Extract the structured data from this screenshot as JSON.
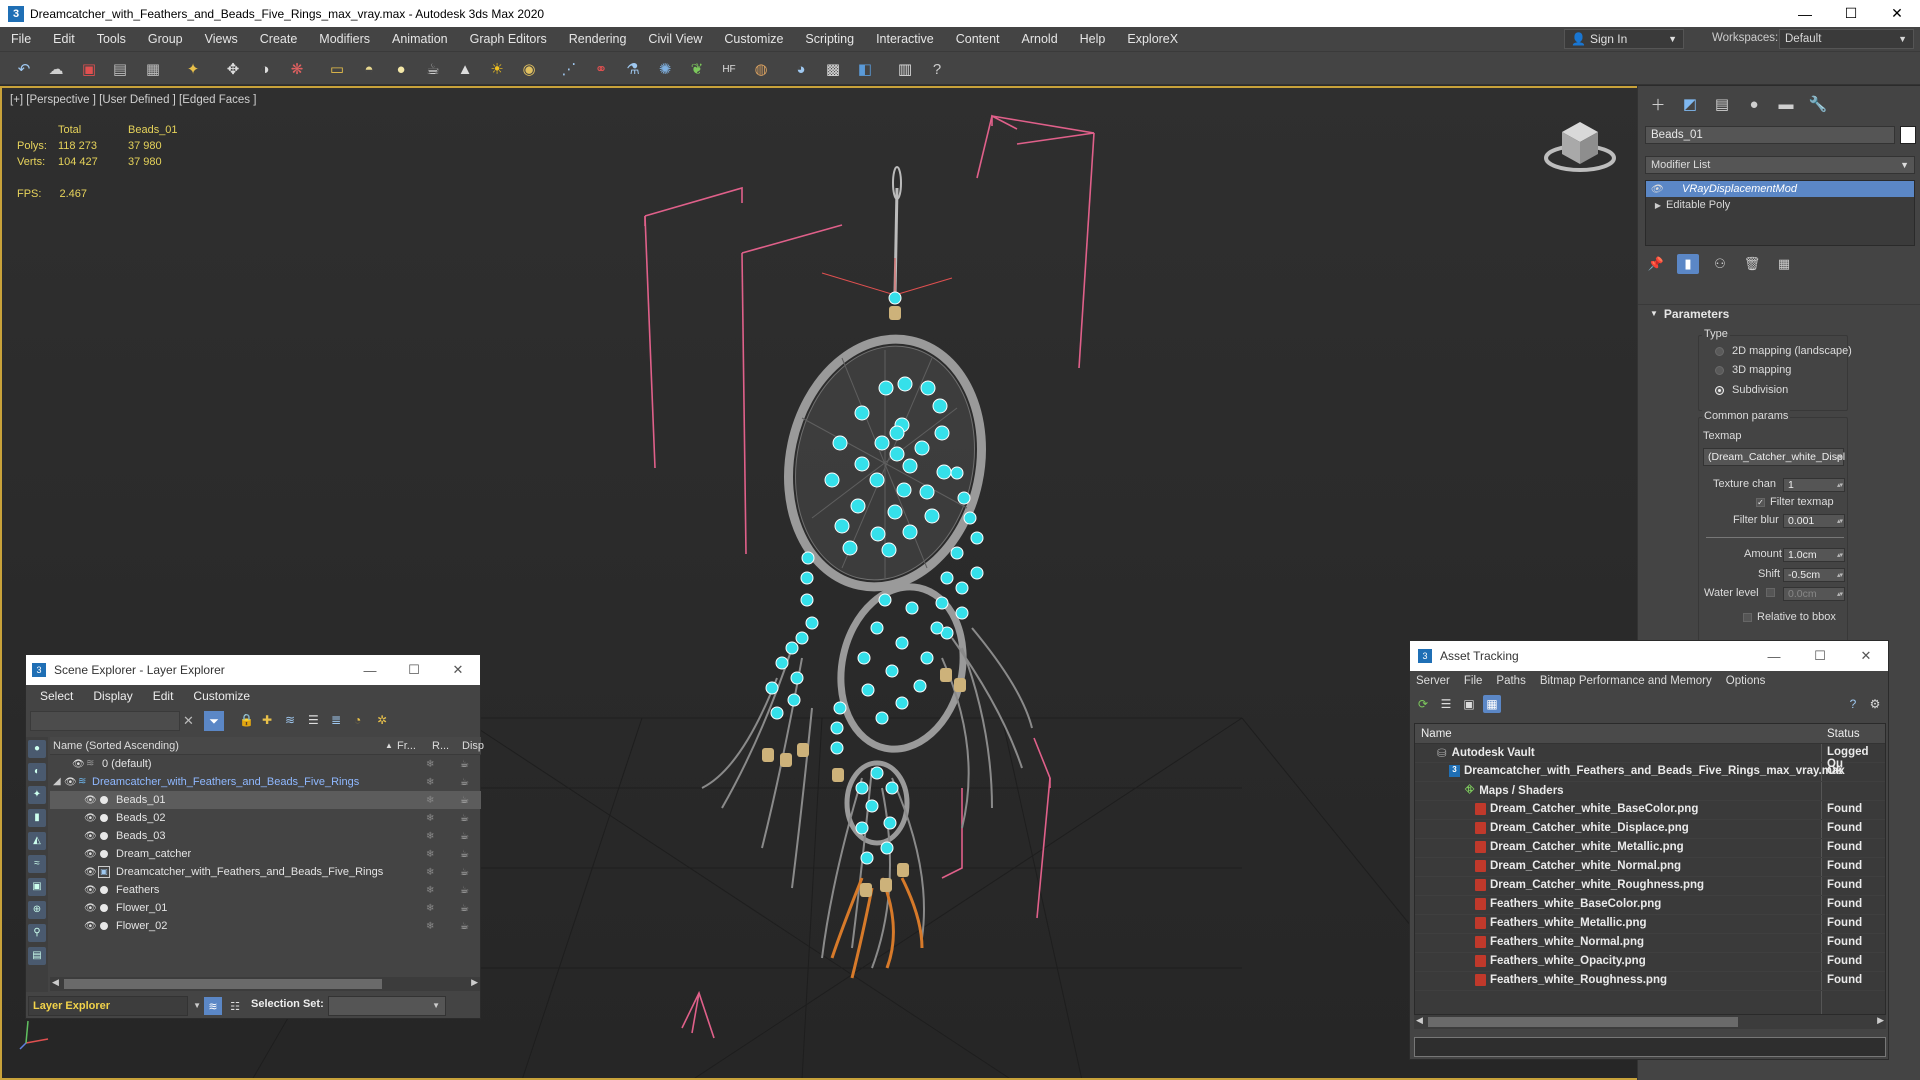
{
  "titlebar": {
    "app_icon": "3",
    "title": "Dreamcatcher_with_Feathers_and_Beads_Five_Rings_max_vray.max - Autodesk 3ds Max 2020",
    "minimize": "—",
    "maximize": "☐",
    "close": "✕"
  },
  "menubar": {
    "items": [
      "File",
      "Edit",
      "Tools",
      "Group",
      "Views",
      "Create",
      "Modifiers",
      "Animation",
      "Graph Editors",
      "Rendering",
      "Civil View",
      "Customize",
      "Scripting",
      "Interactive",
      "Content",
      "Arnold",
      "Help",
      "ExploreX"
    ],
    "signin": "Sign In",
    "workspaces_label": "Workspaces:",
    "workspaces_value": "Default"
  },
  "toolbar": {
    "icons": [
      "undo-icon",
      "redo-icon",
      "link-icon",
      "unlink-icon",
      "bind-icon",
      "select-icon",
      "rect-select-icon",
      "window-crossing-icon",
      "move-icon",
      "rotate-icon",
      "scale-icon",
      "box-icon",
      "sphere-icon",
      "cylinder-icon",
      "teapot-icon",
      "cone-icon",
      "sun-icon",
      "ball-icon",
      "array-icon",
      "mirror-icon",
      "align-icon",
      "layer-icon",
      "plant-icon",
      "hf-icon",
      "material-icon",
      "render-setup-icon",
      "render-frame-icon",
      "render-icon",
      "explorer-icon",
      "help-icon"
    ]
  },
  "viewport": {
    "label": "[+] [Perspective ] [User Defined ] [Edged Faces ]",
    "stats": {
      "header_total": "Total",
      "header_obj": "Beads_01",
      "polys_label": "Polys:",
      "polys_total": "118 273",
      "polys_obj": "37 980",
      "verts_label": "Verts:",
      "verts_total": "104 427",
      "verts_obj": "37 980"
    },
    "fps_label": "FPS:",
    "fps_value": "2.467"
  },
  "command_panel": {
    "object_name": "Beads_01",
    "modifier_list": "Modifier List",
    "stack": [
      {
        "label": "VRayDisplacementMod",
        "selected": true
      },
      {
        "label": "Editable Poly",
        "selected": false
      }
    ],
    "parameters_title": "Parameters",
    "type_label": "Type",
    "radio_options": [
      "2D mapping (landscape)",
      "3D mapping",
      "Subdivision"
    ],
    "radio_selected": "Subdivision",
    "common_params": "Common params",
    "texmap_label": "Texmap",
    "texmap_value": "(Dream_Catcher_white_Displ",
    "texture_chan_label": "Texture chan",
    "texture_chan_value": "1",
    "filter_texmap": "Filter texmap",
    "filter_blur_label": "Filter blur",
    "filter_blur_value": "0.001",
    "amount_label": "Amount",
    "amount_value": "1.0cm",
    "shift_label": "Shift",
    "shift_value": "-0.5cm",
    "water_level_label": "Water level",
    "water_level_value": "0.0cm",
    "relative_bbox": "Relative to bbox"
  },
  "scene_explorer": {
    "title": "Scene Explorer - Layer Explorer",
    "menu": [
      "Select",
      "Display",
      "Edit",
      "Customize"
    ],
    "columns": {
      "name": "Name (Sorted Ascending)",
      "fr": "Fr...",
      "r": "R...",
      "disp": "Disp"
    },
    "rows": [
      {
        "name": "0 (default)",
        "indent": 1
      },
      {
        "name": "Dreamcatcher_with_Feathers_and_Beads_Five_Rings",
        "indent": 0
      },
      {
        "name": "Beads_01",
        "indent": 2
      },
      {
        "name": "Beads_02",
        "indent": 2
      },
      {
        "name": "Beads_03",
        "indent": 2
      },
      {
        "name": "Dream_catcher",
        "indent": 2
      },
      {
        "name": "Dreamcatcher_with_Feathers_and_Beads_Five_Rings",
        "indent": 2
      },
      {
        "name": "Feathers",
        "indent": 2
      },
      {
        "name": "Flower_01",
        "indent": 2
      },
      {
        "name": "Flower_02",
        "indent": 2
      }
    ],
    "layer_explorer": "Layer Explorer",
    "selection_set": "Selection Set:"
  },
  "asset_tracking": {
    "title": "Asset Tracking",
    "menu": [
      "Server",
      "File",
      "Paths",
      "Bitmap Performance and Memory",
      "Options"
    ],
    "col_name": "Name",
    "col_status": "Status",
    "rows": [
      {
        "name": "Autodesk Vault",
        "status": "Logged Ou",
        "indent": 1
      },
      {
        "name": "Dreamcatcher_with_Feathers_and_Beads_Five_Rings_max_vray.max",
        "status": "Ok",
        "indent": 2
      },
      {
        "name": "Maps / Shaders",
        "status": "",
        "indent": 3
      },
      {
        "name": "Dream_Catcher_white_BaseColor.png",
        "status": "Found",
        "indent": 4
      },
      {
        "name": "Dream_Catcher_white_Displace.png",
        "status": "Found",
        "indent": 4
      },
      {
        "name": "Dream_Catcher_white_Metallic.png",
        "status": "Found",
        "indent": 4
      },
      {
        "name": "Dream_Catcher_white_Normal.png",
        "status": "Found",
        "indent": 4
      },
      {
        "name": "Dream_Catcher_white_Roughness.png",
        "status": "Found",
        "indent": 4
      },
      {
        "name": "Feathers_white_BaseColor.png",
        "status": "Found",
        "indent": 4
      },
      {
        "name": "Feathers_white_Metallic.png",
        "status": "Found",
        "indent": 4
      },
      {
        "name": "Feathers_white_Normal.png",
        "status": "Found",
        "indent": 4
      },
      {
        "name": "Feathers_white_Opacity.png",
        "status": "Found",
        "indent": 4
      },
      {
        "name": "Feathers_white_Roughness.png",
        "status": "Found",
        "indent": 4
      }
    ]
  },
  "colors": {
    "accent_selection": "#5b87c6",
    "stats_yellow": "#e8d45c",
    "viewport_border": "#c8a23a",
    "bead_cyan": "#35e0ea",
    "bbox_pink": "#e0608a"
  }
}
